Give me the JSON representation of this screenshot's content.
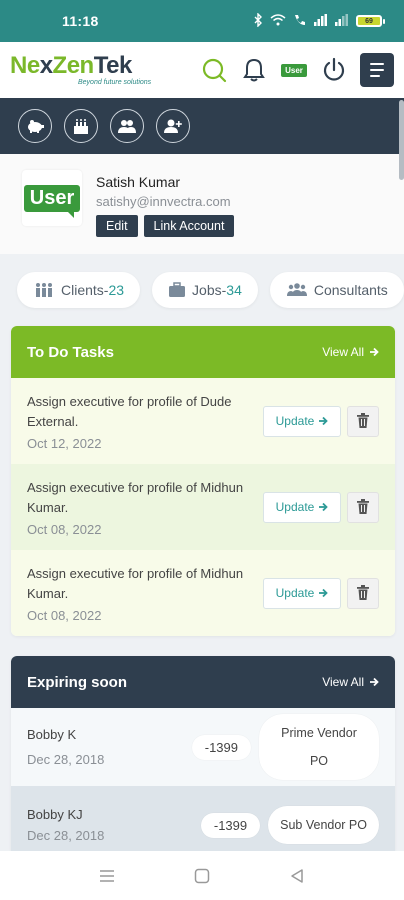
{
  "status_bar": {
    "time": "11:18",
    "battery": "69"
  },
  "header": {
    "logo_green1": "Ne",
    "logo_dark": "x",
    "logo_green2": "Zen",
    "logo_dark2": "Tek",
    "tagline": "Beyond future solutions",
    "user_badge": "User"
  },
  "profile": {
    "avatar_text": "User",
    "name": "Satish Kumar",
    "email": "satishy@innvectra.com",
    "edit_label": "Edit",
    "link_label": "Link Account"
  },
  "stats": [
    {
      "label": "Clients-",
      "count": "23"
    },
    {
      "label": "Jobs-",
      "count": "34"
    },
    {
      "label": "Consultants",
      "count": ""
    }
  ],
  "todo": {
    "title": "To Do Tasks",
    "view_all": "View All",
    "update_label": "Update",
    "tasks": [
      {
        "desc": "Assign executive for profile of Dude External.",
        "date": "Oct 12, 2022"
      },
      {
        "desc": "Assign executive for profile of Midhun Kumar.",
        "date": "Oct 08, 2022"
      },
      {
        "desc": "Assign executive for profile of Midhun Kumar.",
        "date": "Oct 08, 2022"
      }
    ]
  },
  "expiring": {
    "title": "Expiring soon",
    "view_all": "View All",
    "rows": [
      {
        "name": "Bobby K",
        "date": "Dec 28, 2018",
        "count": "-1399",
        "vendor": "Prime Vendor PO"
      },
      {
        "name": "Bobby KJ",
        "date": "Dec 28, 2018",
        "count": "-1399",
        "vendor": "Sub Vendor PO"
      }
    ]
  },
  "colors": {
    "teal": "#2c8a86",
    "green": "#7cba26",
    "navy": "#2f3e4e"
  }
}
